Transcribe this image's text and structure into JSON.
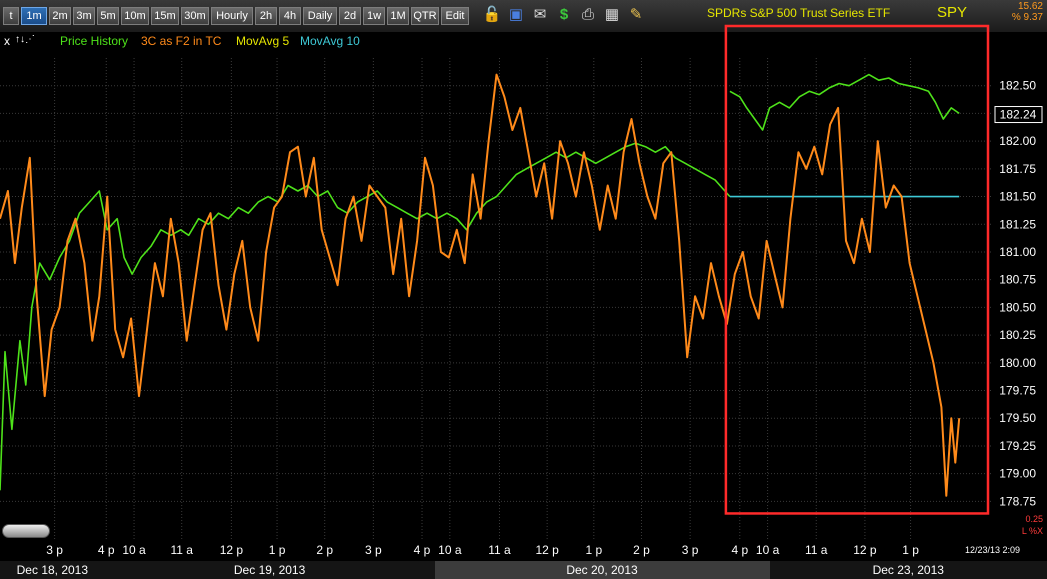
{
  "toolbar": {
    "buttons": [
      "t",
      "1m",
      "2m",
      "3m",
      "5m",
      "10m",
      "15m",
      "30m",
      "Hourly",
      "2h",
      "4h",
      "Daily",
      "2d",
      "1w",
      "1M",
      "QTR",
      "Edit"
    ],
    "active_button": "1m",
    "icons": [
      "lock-icon",
      "save-icon",
      "mail-icon",
      "dollar-icon",
      "print-icon",
      "grid-icon",
      "pencil-icon"
    ]
  },
  "header": {
    "symbol_name": "SPDRs S&P 500 Trust Series ETF",
    "symbol": "SPY",
    "quote_top": "15.62",
    "quote_bottom": "% 9.37"
  },
  "legend": {
    "controls": "x",
    "items": [
      "Price History",
      "3C as F2 in TC",
      "MovAvg 5",
      "MovAvg 10"
    ]
  },
  "footer": {
    "timestamp": "12/23/13 2:09",
    "scale_small": "0.25",
    "scale_label": "L %X"
  },
  "colors": {
    "price": "#4ee21a",
    "indicator": "#ff8a1a",
    "movavg5": "#e6e600",
    "movavg10": "#3ec9d6",
    "highlight_box": "#ff2a2a",
    "grid": "#3a3a3a",
    "axis_text": "#ffffff"
  },
  "chart_data": {
    "type": "line",
    "ylim": [
      178.6,
      182.75
    ],
    "y_ticks": [
      182.5,
      182.25,
      182.0,
      181.75,
      181.5,
      181.25,
      181.0,
      180.75,
      180.5,
      180.25,
      180.0,
      179.75,
      179.5,
      179.25,
      179.0,
      178.75
    ],
    "y_tick_labels": [
      "182.50",
      "182.25",
      "182.00",
      "181.75",
      "181.50",
      "181.25",
      "181.00",
      "180.75",
      "180.50",
      "180.25",
      "180.00",
      "179.75",
      "179.50",
      "179.25",
      "179.00",
      "178.75"
    ],
    "current_price": 182.24,
    "current_price_label": "182.24",
    "x_tick_labels": [
      "3 p",
      "4 p",
      "10 a",
      "11 a",
      "12 p",
      "1 p",
      "2 p",
      "3 p",
      "4 p",
      "10 a",
      "11 a",
      "12 p",
      "1 p",
      "2 p",
      "3 p",
      "4 p",
      "10 a",
      "11 a",
      "12 p",
      "1 p"
    ],
    "x_tick_index": [
      0.055,
      0.107,
      0.135,
      0.183,
      0.233,
      0.279,
      0.327,
      0.376,
      0.425,
      0.453,
      0.503,
      0.551,
      0.598,
      0.646,
      0.695,
      0.745,
      0.773,
      0.822,
      0.871,
      0.917
    ],
    "dates": [
      "Dec 18, 2013",
      "Dec 19, 2013",
      "Dec 20, 2013",
      "Dec 23, 2013"
    ],
    "date_spans": [
      [
        0.0,
        0.1
      ],
      [
        0.1,
        0.415
      ],
      [
        0.415,
        0.735
      ],
      [
        0.735,
        1.0
      ]
    ],
    "highlight_range": [
      0.73,
      1.0
    ],
    "highlight_ylim": [
      178.65,
      182.75
    ],
    "series": [
      {
        "name": "Price History",
        "color": "#4ee21a",
        "points": [
          [
            0.0,
            178.85
          ],
          [
            0.005,
            180.1
          ],
          [
            0.012,
            179.4
          ],
          [
            0.02,
            180.2
          ],
          [
            0.026,
            179.8
          ],
          [
            0.032,
            180.5
          ],
          [
            0.04,
            180.9
          ],
          [
            0.05,
            180.75
          ],
          [
            0.06,
            180.95
          ],
          [
            0.07,
            181.1
          ],
          [
            0.08,
            181.35
          ],
          [
            0.09,
            181.45
          ],
          [
            0.1,
            181.55
          ],
          [
            0.108,
            181.2
          ],
          [
            0.118,
            181.3
          ],
          [
            0.125,
            180.95
          ],
          [
            0.133,
            180.8
          ],
          [
            0.142,
            180.95
          ],
          [
            0.152,
            181.05
          ],
          [
            0.162,
            181.2
          ],
          [
            0.172,
            181.15
          ],
          [
            0.182,
            181.2
          ],
          [
            0.19,
            181.15
          ],
          [
            0.2,
            181.3
          ],
          [
            0.21,
            181.25
          ],
          [
            0.22,
            181.35
          ],
          [
            0.23,
            181.3
          ],
          [
            0.24,
            181.4
          ],
          [
            0.25,
            181.35
          ],
          [
            0.26,
            181.45
          ],
          [
            0.27,
            181.5
          ],
          [
            0.28,
            181.45
          ],
          [
            0.29,
            181.6
          ],
          [
            0.3,
            181.55
          ],
          [
            0.31,
            181.6
          ],
          [
            0.32,
            181.5
          ],
          [
            0.33,
            181.55
          ],
          [
            0.34,
            181.4
          ],
          [
            0.35,
            181.35
          ],
          [
            0.36,
            181.45
          ],
          [
            0.37,
            181.5
          ],
          [
            0.38,
            181.55
          ],
          [
            0.39,
            181.45
          ],
          [
            0.4,
            181.4
          ],
          [
            0.41,
            181.35
          ],
          [
            0.42,
            181.3
          ],
          [
            0.43,
            181.35
          ],
          [
            0.44,
            181.3
          ],
          [
            0.45,
            181.35
          ],
          [
            0.46,
            181.3
          ],
          [
            0.47,
            181.2
          ],
          [
            0.48,
            181.35
          ],
          [
            0.49,
            181.45
          ],
          [
            0.5,
            181.5
          ],
          [
            0.51,
            181.6
          ],
          [
            0.52,
            181.7
          ],
          [
            0.53,
            181.75
          ],
          [
            0.54,
            181.8
          ],
          [
            0.55,
            181.85
          ],
          [
            0.56,
            181.9
          ],
          [
            0.57,
            181.85
          ],
          [
            0.58,
            181.9
          ],
          [
            0.59,
            181.85
          ],
          [
            0.6,
            181.8
          ],
          [
            0.61,
            181.85
          ],
          [
            0.62,
            181.9
          ],
          [
            0.63,
            181.95
          ],
          [
            0.64,
            181.98
          ],
          [
            0.65,
            181.95
          ],
          [
            0.66,
            181.9
          ],
          [
            0.67,
            181.95
          ],
          [
            0.68,
            181.85
          ],
          [
            0.69,
            181.8
          ],
          [
            0.7,
            181.75
          ],
          [
            0.71,
            181.7
          ],
          [
            0.72,
            181.65
          ],
          [
            0.73,
            181.55
          ],
          [
            0.735,
            181.5
          ]
        ]
      },
      {
        "name": "Price History (Dec 23)",
        "color": "#4ee21a",
        "points": [
          [
            0.735,
            182.45
          ],
          [
            0.745,
            182.4
          ],
          [
            0.752,
            182.3
          ],
          [
            0.76,
            182.2
          ],
          [
            0.768,
            182.1
          ],
          [
            0.775,
            182.3
          ],
          [
            0.785,
            182.35
          ],
          [
            0.795,
            182.3
          ],
          [
            0.805,
            182.4
          ],
          [
            0.815,
            182.45
          ],
          [
            0.825,
            182.42
          ],
          [
            0.835,
            182.48
          ],
          [
            0.845,
            182.52
          ],
          [
            0.855,
            182.5
          ],
          [
            0.865,
            182.55
          ],
          [
            0.875,
            182.6
          ],
          [
            0.885,
            182.55
          ],
          [
            0.895,
            182.57
          ],
          [
            0.905,
            182.52
          ],
          [
            0.915,
            182.5
          ],
          [
            0.925,
            182.48
          ],
          [
            0.935,
            182.45
          ],
          [
            0.942,
            182.35
          ],
          [
            0.95,
            182.2
          ],
          [
            0.958,
            182.3
          ],
          [
            0.966,
            182.25
          ]
        ]
      },
      {
        "name": "MovAvg 10",
        "color": "#3ec9d6",
        "points": [
          [
            0.735,
            181.5
          ],
          [
            0.966,
            181.5
          ]
        ]
      },
      {
        "name": "3C as F2 in TC",
        "color": "#ff8a1a",
        "points": [
          [
            0.0,
            181.3
          ],
          [
            0.008,
            181.55
          ],
          [
            0.015,
            180.9
          ],
          [
            0.022,
            181.4
          ],
          [
            0.03,
            181.85
          ],
          [
            0.037,
            180.6
          ],
          [
            0.045,
            179.7
          ],
          [
            0.052,
            180.3
          ],
          [
            0.06,
            180.5
          ],
          [
            0.068,
            181.1
          ],
          [
            0.076,
            181.3
          ],
          [
            0.085,
            180.9
          ],
          [
            0.093,
            180.2
          ],
          [
            0.1,
            180.6
          ],
          [
            0.108,
            181.5
          ],
          [
            0.116,
            180.3
          ],
          [
            0.124,
            180.05
          ],
          [
            0.132,
            180.4
          ],
          [
            0.14,
            179.7
          ],
          [
            0.148,
            180.3
          ],
          [
            0.156,
            180.9
          ],
          [
            0.164,
            180.6
          ],
          [
            0.172,
            181.3
          ],
          [
            0.18,
            180.9
          ],
          [
            0.188,
            180.2
          ],
          [
            0.196,
            180.7
          ],
          [
            0.204,
            181.2
          ],
          [
            0.212,
            181.35
          ],
          [
            0.22,
            180.7
          ],
          [
            0.228,
            180.3
          ],
          [
            0.236,
            180.8
          ],
          [
            0.244,
            181.1
          ],
          [
            0.252,
            180.5
          ],
          [
            0.26,
            180.2
          ],
          [
            0.268,
            181.0
          ],
          [
            0.276,
            181.4
          ],
          [
            0.284,
            181.5
          ],
          [
            0.292,
            181.9
          ],
          [
            0.3,
            181.95
          ],
          [
            0.308,
            181.5
          ],
          [
            0.316,
            181.85
          ],
          [
            0.324,
            181.2
          ],
          [
            0.332,
            180.95
          ],
          [
            0.34,
            180.7
          ],
          [
            0.348,
            181.3
          ],
          [
            0.356,
            181.5
          ],
          [
            0.364,
            181.1
          ],
          [
            0.372,
            181.6
          ],
          [
            0.38,
            181.5
          ],
          [
            0.388,
            181.4
          ],
          [
            0.396,
            180.8
          ],
          [
            0.404,
            181.3
          ],
          [
            0.412,
            180.6
          ],
          [
            0.42,
            181.1
          ],
          [
            0.428,
            181.85
          ],
          [
            0.436,
            181.6
          ],
          [
            0.444,
            181.0
          ],
          [
            0.452,
            180.95
          ],
          [
            0.46,
            181.2
          ],
          [
            0.468,
            180.9
          ],
          [
            0.476,
            181.7
          ],
          [
            0.484,
            181.3
          ],
          [
            0.492,
            182.0
          ],
          [
            0.5,
            182.6
          ],
          [
            0.508,
            182.4
          ],
          [
            0.516,
            182.1
          ],
          [
            0.524,
            182.3
          ],
          [
            0.532,
            181.9
          ],
          [
            0.54,
            181.5
          ],
          [
            0.548,
            181.8
          ],
          [
            0.556,
            181.3
          ],
          [
            0.564,
            182.0
          ],
          [
            0.572,
            181.8
          ],
          [
            0.58,
            181.5
          ],
          [
            0.588,
            181.9
          ],
          [
            0.596,
            181.6
          ],
          [
            0.604,
            181.2
          ],
          [
            0.612,
            181.6
          ],
          [
            0.62,
            181.3
          ],
          [
            0.628,
            181.9
          ],
          [
            0.636,
            182.2
          ],
          [
            0.644,
            181.8
          ],
          [
            0.652,
            181.5
          ],
          [
            0.66,
            181.3
          ],
          [
            0.668,
            181.8
          ],
          [
            0.676,
            181.9
          ],
          [
            0.684,
            181.1
          ],
          [
            0.692,
            180.05
          ],
          [
            0.7,
            180.6
          ],
          [
            0.708,
            180.4
          ],
          [
            0.716,
            180.9
          ],
          [
            0.724,
            180.6
          ],
          [
            0.732,
            180.35
          ],
          [
            0.74,
            180.8
          ],
          [
            0.748,
            181.0
          ],
          [
            0.756,
            180.6
          ],
          [
            0.764,
            180.4
          ],
          [
            0.772,
            181.1
          ],
          [
            0.78,
            180.8
          ],
          [
            0.788,
            180.5
          ],
          [
            0.796,
            181.3
          ],
          [
            0.804,
            181.9
          ],
          [
            0.812,
            181.75
          ],
          [
            0.82,
            181.95
          ],
          [
            0.828,
            181.7
          ],
          [
            0.836,
            182.15
          ],
          [
            0.844,
            182.3
          ],
          [
            0.852,
            181.1
          ],
          [
            0.86,
            180.9
          ],
          [
            0.868,
            181.3
          ],
          [
            0.876,
            181.0
          ],
          [
            0.884,
            182.0
          ],
          [
            0.892,
            181.4
          ],
          [
            0.9,
            181.6
          ],
          [
            0.908,
            181.5
          ],
          [
            0.916,
            180.9
          ],
          [
            0.924,
            180.6
          ],
          [
            0.932,
            180.3
          ],
          [
            0.94,
            180.0
          ],
          [
            0.948,
            179.6
          ],
          [
            0.953,
            178.8
          ],
          [
            0.958,
            179.5
          ],
          [
            0.962,
            179.1
          ],
          [
            0.966,
            179.5
          ]
        ]
      }
    ]
  }
}
